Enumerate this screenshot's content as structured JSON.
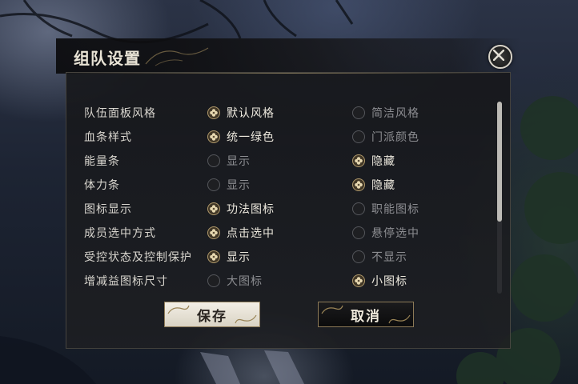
{
  "dialog": {
    "title": "组队设置",
    "close_icon": "close-icon"
  },
  "settings": [
    {
      "label": "队伍面板风格",
      "option_a": "默认风格",
      "option_b": "简洁风格",
      "selected": "a"
    },
    {
      "label": "血条样式",
      "option_a": "统一绿色",
      "option_b": "门派颜色",
      "selected": "a"
    },
    {
      "label": "能量条",
      "option_a": "显示",
      "option_b": "隐藏",
      "selected": "b"
    },
    {
      "label": "体力条",
      "option_a": "显示",
      "option_b": "隐藏",
      "selected": "b"
    },
    {
      "label": "图标显示",
      "option_a": "功法图标",
      "option_b": "职能图标",
      "selected": "a"
    },
    {
      "label": "成员选中方式",
      "option_a": "点击选中",
      "option_b": "悬停选中",
      "selected": "a"
    },
    {
      "label": "受控状态及控制保护",
      "option_a": "显示",
      "option_b": "不显示",
      "selected": "a"
    },
    {
      "label": "增减益图标尺寸",
      "option_a": "大图标",
      "option_b": "小图标",
      "selected": "b"
    }
  ],
  "buttons": {
    "save": "保存",
    "cancel": "取消"
  },
  "colors": {
    "accent_gold": "#b19a6c",
    "text_selected": "#ece8dd",
    "text_unselected": "#8c8d91"
  }
}
